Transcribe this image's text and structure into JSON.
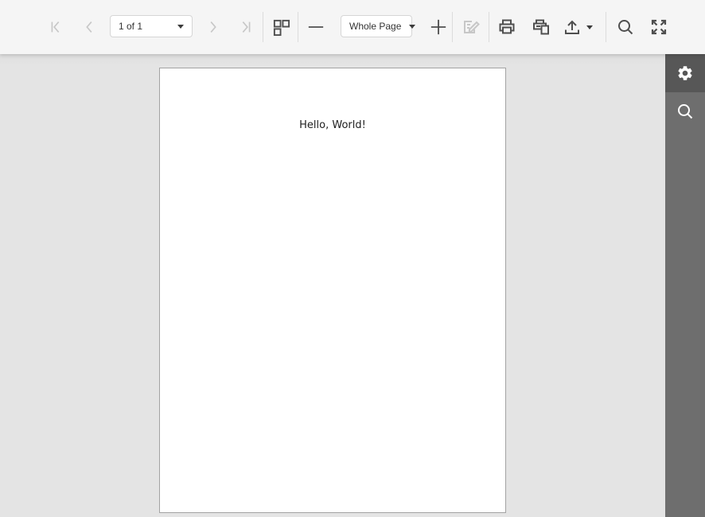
{
  "toolbar": {
    "first_page_label": "Go to first page",
    "prev_page_label": "Go to previous page",
    "next_page_label": "Go to next page",
    "last_page_label": "Go to last page",
    "page_selector": {
      "value": "1 of 1"
    },
    "zoom_selector": {
      "value": "Whole Page"
    },
    "buttons": [
      {
        "name": "toggle-multipage",
        "icon": "page-layout-squares-icon",
        "enabled": true
      },
      {
        "name": "zoom-out",
        "icon": "minus-icon",
        "enabled": true
      },
      {
        "name": "zoom-in",
        "icon": "plus-icon",
        "enabled": true
      },
      {
        "name": "edit-parameters",
        "icon": "edit-form-pencil-icon",
        "enabled": false
      },
      {
        "name": "print",
        "icon": "printer-icon",
        "enabled": true
      },
      {
        "name": "print-preview",
        "icon": "printer-page-icon",
        "enabled": true
      },
      {
        "name": "export",
        "icon": "upload-tray-arrow-icon",
        "has_dropdown": true,
        "enabled": true
      },
      {
        "name": "search",
        "icon": "magnifier-icon",
        "enabled": true
      },
      {
        "name": "fullscreen",
        "icon": "expand-arrows-icon",
        "enabled": true
      }
    ]
  },
  "document": {
    "text": "Hello, World!"
  },
  "side_menu": {
    "items": [
      {
        "name": "settings",
        "icon": "gear-icon",
        "active": true
      },
      {
        "name": "search",
        "icon": "magnifier-icon",
        "active": false
      }
    ]
  },
  "colors": {
    "toolbar_bg": "#f5f5f5",
    "content_bg": "#e3e3e3",
    "sidebar_bg": "#6e6e6e",
    "sidebar_active_bg": "#575757",
    "icon": "#4f4f4f",
    "icon_disabled": "#c7c7c7",
    "dropdown_border": "#d6d6d6",
    "page_border": "#a3a3a3",
    "page_text": "#1e1e1e"
  }
}
